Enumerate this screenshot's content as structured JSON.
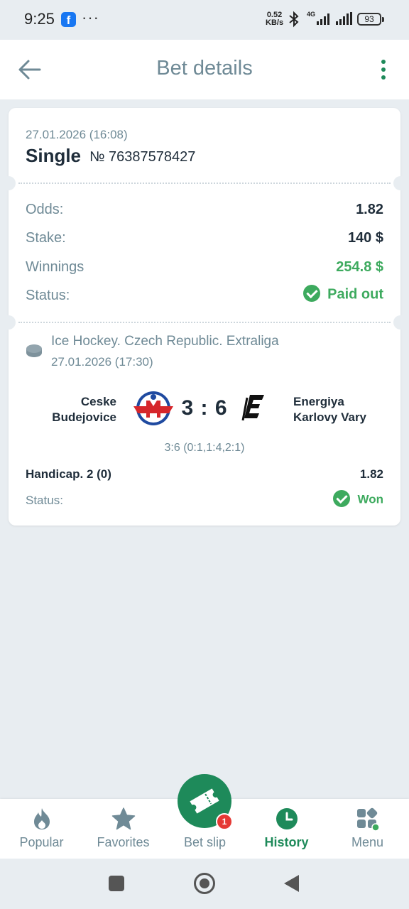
{
  "status_bar": {
    "time": "9:25",
    "fb_glyph": "f",
    "dots": "···",
    "speed_value": "0.52",
    "speed_unit": "KB/s",
    "network": "4G",
    "battery": "93"
  },
  "header": {
    "title": "Bet details",
    "back_icon": "arrow-left-icon",
    "more_icon": "kebab-menu-icon"
  },
  "bet": {
    "date": "27.01.2026 (16:08)",
    "type": "Single",
    "number": "№ 76387578427",
    "rows": [
      {
        "label": "Odds:",
        "value": "1.82"
      },
      {
        "label": "Stake:",
        "value": "140 $"
      },
      {
        "label": "Winnings",
        "value": "254.8 $"
      },
      {
        "label": "Status:",
        "value": "Paid out"
      }
    ]
  },
  "event": {
    "league": "Ice Hockey. Czech Republic. Extraliga",
    "date": "27.01.2026 (17:30)",
    "team1_line1": "Ceske",
    "team1_line2": "Budejovice",
    "team2_line1": "Energiya",
    "team2_line2": "Karlovy Vary",
    "score": "3 : 6",
    "score_detail": "3:6 (0:1,1:4,2:1)",
    "market": "Handicap. 2 (0)",
    "odds": "1.82",
    "status_label": "Status:",
    "status": "Won"
  },
  "colors": {
    "accent": "#1e8a5a",
    "success": "#3daa5e",
    "muted": "#6f8a96",
    "background": "#e8edf1"
  },
  "bottom_nav": {
    "items": [
      {
        "label": "Popular",
        "icon": "flame-icon"
      },
      {
        "label": "Favorites",
        "icon": "star-icon"
      },
      {
        "label": "Bet slip",
        "icon": "ticket-icon"
      },
      {
        "label": "History",
        "icon": "clock-icon"
      },
      {
        "label": "Menu",
        "icon": "grid-icon"
      }
    ],
    "active": "History",
    "bet_slip_badge": "1"
  }
}
